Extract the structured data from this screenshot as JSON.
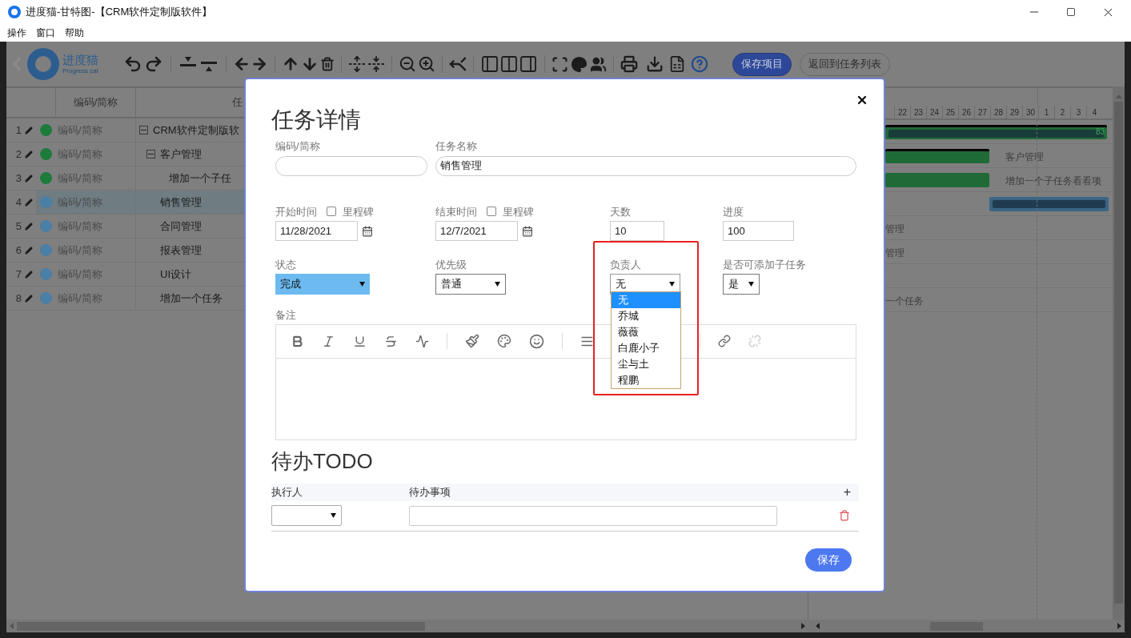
{
  "window": {
    "title": "进度猫-甘特图-【CRM软件定制版软件】"
  },
  "menu": [
    "操作",
    "窗口",
    "帮助"
  ],
  "toolbar": {
    "logo_text": "进度猫",
    "logo_subtitle": "Progress cat",
    "buttons": [
      {
        "label": "保存项目",
        "kind": "primary"
      },
      {
        "label": "返回到任务列表",
        "kind": "outline"
      }
    ]
  },
  "task_table": {
    "columns": [
      "编码/简称",
      "任"
    ],
    "rows": [
      {
        "number": "1",
        "color": "#1e7b3c",
        "code": "编码/简称",
        "name": "CRM软件定制版软",
        "selected": false,
        "expanded": true,
        "children": [
          {
            "number": "2",
            "color": "#1e7b3c",
            "code": "编码/简称",
            "name": "客户管理",
            "selected": false,
            "expanded": true,
            "children": [
              {
                "number": "3",
                "color": "#1e7b3c",
                "code": "编码/简称",
                "name": "增加一个子任",
                "selected": false
              }
            ]
          },
          {
            "number": "4",
            "color": "#4a7fa6",
            "code": "编码/简称",
            "name": "销售管理",
            "selected": true
          },
          {
            "number": "5",
            "color": "#4a7fa6",
            "code": "编码/简称",
            "name": "合同管理",
            "selected": false
          },
          {
            "number": "6",
            "color": "#4a7fa6",
            "code": "编码/简称",
            "name": "报表管理",
            "selected": false
          },
          {
            "number": "7",
            "color": "#4a7fa6",
            "code": "编码/简称",
            "name": "UI设计",
            "selected": false
          },
          {
            "number": "8",
            "color": "#4a7fa6",
            "code": "编码/简称",
            "name": "增加一个任务",
            "selected": false
          }
        ]
      }
    ]
  },
  "gantt": {
    "days": [
      "22",
      "23",
      "24",
      "25",
      "26",
      "27",
      "28",
      "29",
      "30",
      "1",
      "2",
      "3",
      "4"
    ],
    "rows": [
      {
        "bar": {
          "kind": "project"
        },
        "label": "83"
      },
      {
        "bar": {
          "kind": "summary"
        },
        "label": "客户管理"
      },
      {
        "bar": {
          "kind": "task"
        },
        "label": "增加一个子任务看看项"
      },
      {
        "bar": {
          "kind": "active"
        }
      },
      {
        "label": "管理"
      },
      {
        "label": "管理"
      },
      {},
      {
        "label": "一个任务"
      }
    ]
  },
  "dialog": {
    "title": "任务详情",
    "code": {
      "label": "编码/简称"
    },
    "name": {
      "label": "任务名称",
      "value": "销售管理"
    },
    "start": {
      "label": "开始时间",
      "milestone": {
        "label": "里程碑",
        "checked": false
      },
      "value": "11/28/2021"
    },
    "end": {
      "label": "结束时间",
      "milestone": {
        "label": "里程碑",
        "checked": false
      },
      "value": "12/7/2021"
    },
    "days": {
      "label": "天数",
      "value": "10"
    },
    "progress": {
      "label": "进度",
      "value": "100"
    },
    "status": {
      "label": "状态",
      "value": "完成"
    },
    "priority": {
      "label": "优先级",
      "value": "普通"
    },
    "owner": {
      "label": "负责人",
      "value": "无",
      "expanded": true,
      "options": [
        {
          "label": "无",
          "selected": true
        },
        {
          "label": "乔城",
          "selected": false
        },
        {
          "label": "薇薇",
          "selected": false
        },
        {
          "label": "白鹿小子",
          "selected": false
        },
        {
          "label": "尘与土",
          "selected": false
        },
        {
          "label": "程鹏",
          "selected": false
        }
      ]
    },
    "subtasks": {
      "label": "是否可添加子任务",
      "value": "是"
    },
    "notes": {
      "label": "备注"
    },
    "todo": {
      "title": "待办TODO",
      "columns": [
        "执行人",
        "待办事项"
      ],
      "add": "+"
    },
    "save": "保存"
  }
}
